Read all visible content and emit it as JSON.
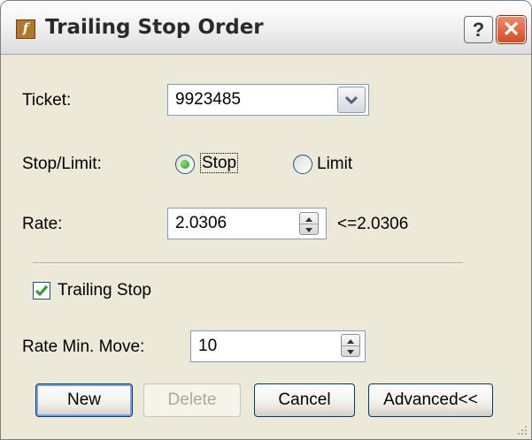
{
  "window": {
    "title": "Trailing Stop Order",
    "app_icon": "fx-icon",
    "help_label": "?",
    "close_label": "✕"
  },
  "form": {
    "ticket": {
      "label": "Ticket:",
      "value": "9923485"
    },
    "stop_limit": {
      "label": "Stop/Limit:",
      "options": [
        "Stop",
        "Limit"
      ],
      "selected": "Stop"
    },
    "rate": {
      "label": "Rate:",
      "value": "2.0306",
      "constraint": "<=2.0306"
    },
    "trailing_stop": {
      "label": "Trailing Stop",
      "checked": true
    },
    "rate_min_move": {
      "label": "Rate Min. Move:",
      "value": "10"
    }
  },
  "buttons": {
    "new": "New",
    "delete": "Delete",
    "cancel": "Cancel",
    "advanced": "Advanced<<"
  },
  "colors": {
    "dialog_bg": "#ece9d8",
    "field_border": "#7f9db9",
    "accent_green": "#21a121",
    "close_red": "#d64a24"
  }
}
